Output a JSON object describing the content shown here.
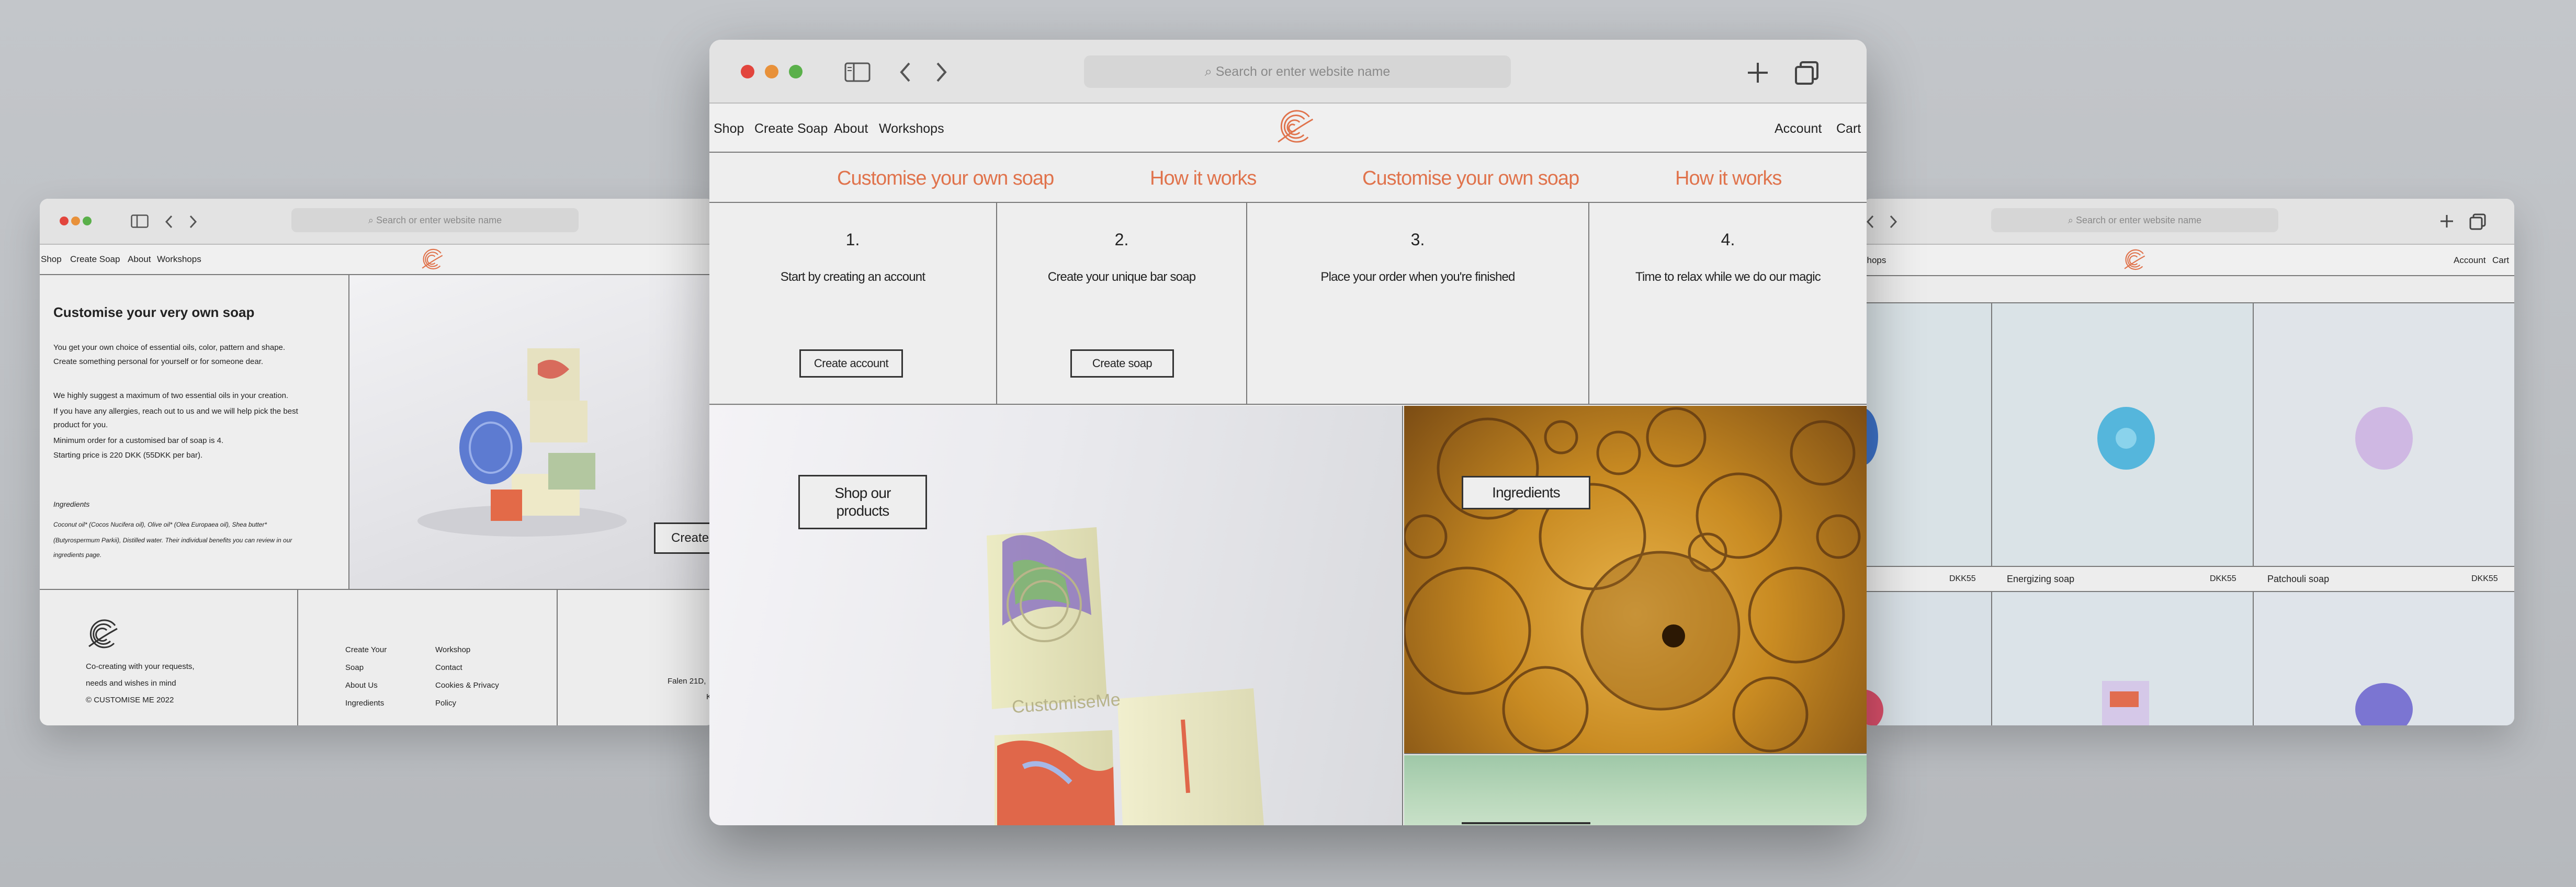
{
  "left_window": {
    "url_placeholder": "Search or enter website name",
    "nav": {
      "shop": "Shop",
      "create": "Create Soap",
      "about": "About",
      "workshops": "Workshops"
    },
    "heading": "Customise your very own soap",
    "paragraphs": [
      "You get your own choice of essential oils, color, pattern and shape.",
      "Create something personal for yourself or for someone dear.",
      "We highly suggest a maximum of two essential oils in your creation.",
      "If you have any allergies, reach out to us and we will help pick the best",
      "product for you.",
      "Minimum order for a customised bar of soap is 4.",
      "Starting price is 220 DKK (55DKK per bar)."
    ],
    "ingredients_title": "Ingredients",
    "ingredients_lines": [
      "Coconut oil* (Cocos Nucifera oil), Olive oil* (Olea Europaea oil), Shea butter*",
      "(Butyrospermum Parkii), Distilled water. Their individual benefits you can review in our",
      "ingredients page."
    ],
    "image_button": "Create",
    "footer": {
      "tagline_1": "Co-creating with your requests,",
      "tagline_2": "needs and wishes in mind",
      "copyright": "© CUSTOMISE ME 2022",
      "col1": [
        "Create Your",
        "Soap",
        "About Us",
        "Ingredients"
      ],
      "col2": [
        "Workshop",
        "Contact",
        "Cookies & Privacy",
        "Policy"
      ],
      "address_1": "Falen 21D,",
      "address_2": "K"
    }
  },
  "main_window": {
    "url_placeholder": "Search or enter website name",
    "nav": {
      "shop": "Shop",
      "create": "Create Soap",
      "about": "About",
      "workshops": "Workshops",
      "account": "Account",
      "cart": "Cart"
    },
    "marquee": [
      "Customise your own soap",
      "How it works",
      "Customise your own soap",
      "How it works"
    ],
    "steps": [
      {
        "num": "1.",
        "text": "Start by creating an account",
        "button": "Create account"
      },
      {
        "num": "2.",
        "text": "Create your unique bar soap",
        "button": "Create soap"
      },
      {
        "num": "3.",
        "text": "Place your order when you're finished"
      },
      {
        "num": "4.",
        "text": "Time to relax while we do our magic"
      }
    ],
    "shop_button_line1": "Shop our",
    "shop_button_line2": "products",
    "ingredients_button": "Ingredients",
    "soap_stamp": "CustomiseMe"
  },
  "right_window": {
    "url_placeholder": "Search or enter website name",
    "nav": {
      "workshops_partial": "shops",
      "account": "Account",
      "cart": "Cart"
    },
    "products": [
      {
        "name": "",
        "price": "DKK55"
      },
      {
        "name": "Energizing soap",
        "price": "DKK55"
      },
      {
        "name": "Patchouli soap",
        "price": "DKK55"
      }
    ]
  },
  "colors": {
    "accent": "#e0734c",
    "bg": "#bfc2c6",
    "page": "#eeeeee",
    "border": "#777777"
  }
}
